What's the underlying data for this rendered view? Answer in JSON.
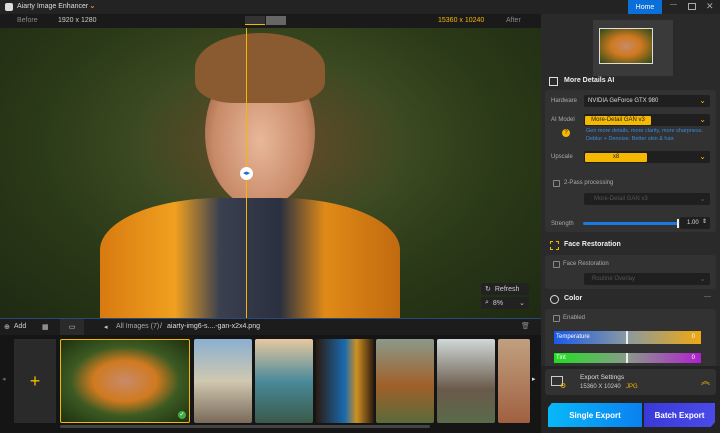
{
  "app": {
    "title": "Aiarty Image Enhancer",
    "home": "Home"
  },
  "compare": {
    "before": "Before",
    "before_size": "1920 x 1280",
    "after_size": "15360 x 10240",
    "after": "After"
  },
  "viewer": {
    "refresh": "Refresh",
    "zoom": "8%"
  },
  "toolbar": {
    "add": "Add",
    "breadcrumb_root": "All Images (7)",
    "separator": "/",
    "filename": "aiarty-img6-s....-gan-x2x4.png"
  },
  "panel": {
    "details_title": "More Details AI",
    "hardware_label": "Hardware",
    "hardware_value": "NVIDIA GeForce GTX 980",
    "model_label": "AI Model",
    "model_value": "More-Detail GAN  v3",
    "model_desc": "Gen more details, more clarity, more sharpness. Deblur + Denoise. Better skin & hair.",
    "upscale_label": "Upscale",
    "upscale_value": "x8",
    "twopass_label": "2-Pass processing",
    "twopass_model": "More-Detail GAN  v3",
    "strength_label": "Strength",
    "strength_value": "1.00",
    "strength_fraction": 1.0,
    "face_title": "Face Restoration",
    "face_check": "Face Restoration",
    "face_mode": "Routine Overlay",
    "color_title": "Color",
    "enabled": "Enabled",
    "temperature_label": "Temperature",
    "temperature_value": "0",
    "tint_label": "Tint",
    "tint_value": "0",
    "export_title": "Export Settings",
    "export_size": "15360 X 10240",
    "export_format": "JPG",
    "single_export": "Single Export",
    "batch_export": "Batch Export"
  },
  "colors": {
    "accent": "#f5b800",
    "home": "#0a6fd8",
    "single": "#0aa0f0",
    "batch": "#3a3ae0"
  },
  "thumbnails": [
    "boy",
    "havana",
    "coast",
    "parrot",
    "highland-cow",
    "deer",
    "city"
  ]
}
